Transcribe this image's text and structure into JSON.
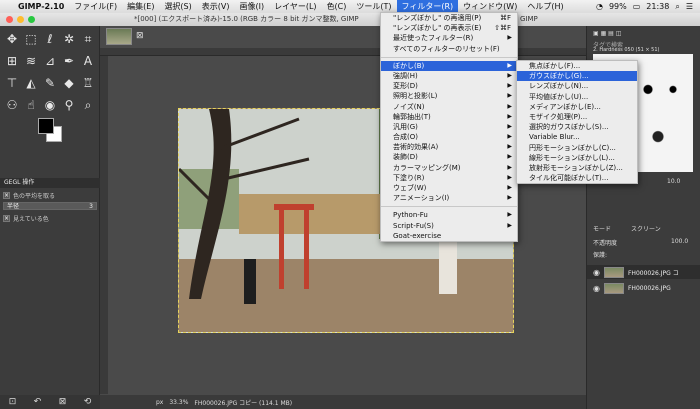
{
  "macmenu": {
    "app": "GIMP-2.10",
    "items": [
      "ファイル(F)",
      "編集(E)",
      "選択(S)",
      "表示(V)",
      "画像(I)",
      "レイヤー(L)",
      "色(C)",
      "ツール(T)",
      "フィルター(R)",
      "ウィンドウ(W)",
      "ヘルプ(H)"
    ],
    "battery": "99%",
    "time": "21:38"
  },
  "window": {
    "title": "*[000] (エクスポート済み)-15.0 (RGB カラー 8 bit ガンマ整数, GIMP",
    "title_right": "GIMP"
  },
  "filters_menu": {
    "items": [
      {
        "label": "\"レンズぼかし\" の再適用(P)",
        "shortcut": "⌘F"
      },
      {
        "label": "\"レンズぼかし\" の再表示(E)",
        "shortcut": "⇧⌘F"
      },
      {
        "label": "最近使ったフィルター(R)",
        "shortcut": "▶"
      },
      {
        "label": "すべてのフィルターのリセット(F)",
        "shortcut": ""
      },
      {
        "label": "ぼかし(B)",
        "shortcut": "▶"
      },
      {
        "label": "強調(H)",
        "shortcut": "▶"
      },
      {
        "label": "変形(D)",
        "shortcut": "▶"
      },
      {
        "label": "照明と投影(L)",
        "shortcut": "▶"
      },
      {
        "label": "ノイズ(N)",
        "shortcut": "▶"
      },
      {
        "label": "輪郭抽出(T)",
        "shortcut": "▶"
      },
      {
        "label": "汎用(G)",
        "shortcut": "▶"
      },
      {
        "label": "合成(O)",
        "shortcut": "▶"
      },
      {
        "label": "芸術的効果(A)",
        "shortcut": "▶"
      },
      {
        "label": "装飾(D)",
        "shortcut": "▶"
      },
      {
        "label": "カラーマッピング(M)",
        "shortcut": "▶"
      },
      {
        "label": "下塗り(R)",
        "shortcut": "▶"
      },
      {
        "label": "ウェブ(W)",
        "shortcut": "▶"
      },
      {
        "label": "アニメーション(I)",
        "shortcut": "▶"
      },
      {
        "label": "Python-Fu",
        "shortcut": "▶"
      },
      {
        "label": "Script-Fu(S)",
        "shortcut": "▶"
      },
      {
        "label": "Goat-exercise",
        "shortcut": ""
      }
    ]
  },
  "blur_submenu": {
    "items": [
      "焦点ぼかし(F)...",
      "ガウスぼかし(G)...",
      "レンズぼかし(N)...",
      "平均値ぼかし(U)...",
      "メディアンぼかし(E)...",
      "モザイク処理(P)...",
      "選択的ガウスぼかし(S)...",
      "Variable Blur...",
      "円形モーションぼかし(C)...",
      "線形モーションぼかし(L)...",
      "放射形モーションぼかし(Z)...",
      "タイル化可能ぼかし(T)..."
    ]
  },
  "toolbox": {
    "gegl_title": "GEGL 操作",
    "opt1": "色の平均を取る",
    "slider_label": "半径",
    "slider_value": "3",
    "opt2": "見えている色"
  },
  "canvas": {
    "unit": "px",
    "zoom": "33.3%",
    "status": "FH000026.JPG コピー (114.1 MB)"
  },
  "right_panel": {
    "filter_placeholder": "タグで検索",
    "brush_name": "2. Hardness 050 (51 × 51)",
    "brush_value": "10.0",
    "mode_label": "モード",
    "mode_value": "スクリーン",
    "opacity_label": "不透明度",
    "opacity_value": "100.0",
    "lock_label": "保護:",
    "layers": [
      "FH000026.JPG コ",
      "FH000026.JPG"
    ]
  }
}
